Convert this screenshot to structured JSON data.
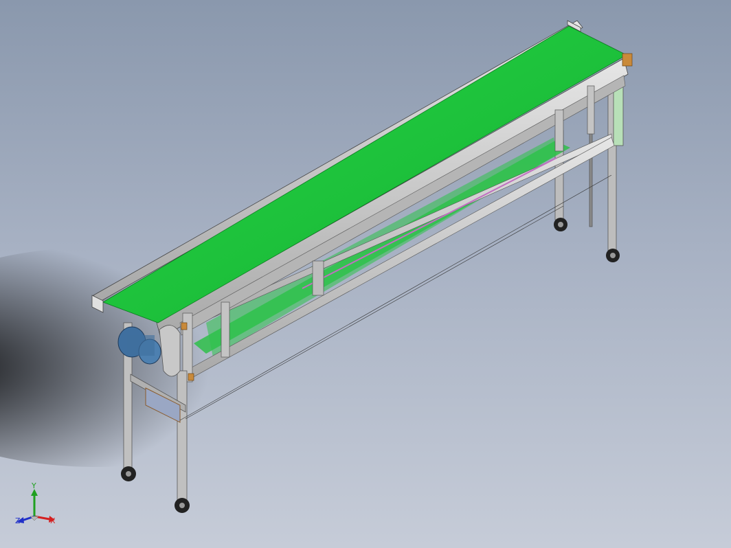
{
  "viewport": {
    "background_top": "#8a98ad",
    "background_bottom": "#c6ccd8"
  },
  "model": {
    "belt_color": "#1ec43c",
    "frame_color": "#cfcfcf",
    "motor_color": "#3f6f9f",
    "bracket_color": "#c98a3a"
  },
  "triad": {
    "x_label": "X",
    "y_label": "Y",
    "z_label": "Z",
    "x_color": "#d42020",
    "y_color": "#20a020",
    "z_color": "#2030c8"
  }
}
